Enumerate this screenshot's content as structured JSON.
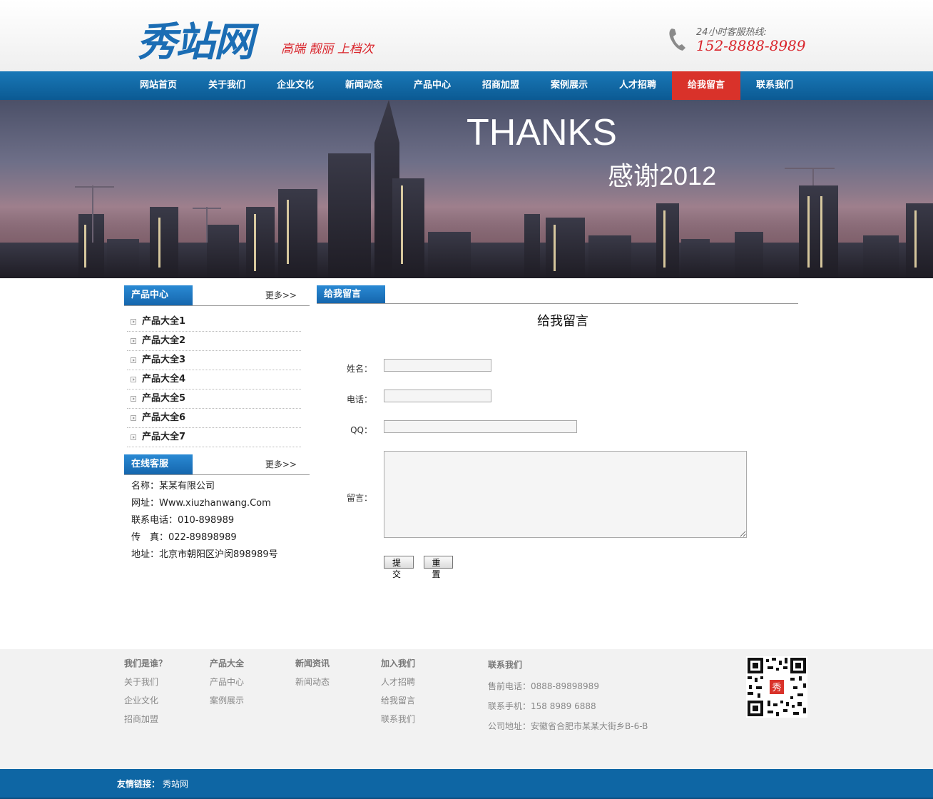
{
  "header": {
    "logo_text": "秀站网",
    "slogan": "高端 靓丽 上档次",
    "hotline_label": "24小时客服热线:",
    "hotline_number": "152-8888-8989"
  },
  "nav": {
    "items": [
      "网站首页",
      "关于我们",
      "企业文化",
      "新闻动态",
      "产品中心",
      "招商加盟",
      "案例展示",
      "人才招聘",
      "给我留言",
      "联系我们"
    ],
    "active": "给我留言"
  },
  "banner": {
    "title": "THANKS",
    "subtitle": "感谢2012"
  },
  "products": {
    "title": "产品中心",
    "more": "更多>>",
    "items": [
      "产品大全1",
      "产品大全2",
      "产品大全3",
      "产品大全4",
      "产品大全5",
      "产品大全6",
      "产品大全7"
    ]
  },
  "service": {
    "title": "在线客服",
    "more": "更多>>",
    "lines": [
      "名称：某某有限公司",
      "网址：Www.xiuzhanwang.Com",
      "联系电话：010-898989",
      "传　真：022-89898989",
      "地址：北京市朝阳区沪闵898989号"
    ]
  },
  "message": {
    "tab": "给我留言",
    "heading": "给我留言",
    "name_label": "姓名：",
    "phone_label": "电话：",
    "qq_label": "QQ：",
    "content_label": "留言：",
    "name_value": "",
    "phone_value": "",
    "qq_value": "",
    "content_value": "",
    "submit_label": "提交",
    "reset_label": "重置"
  },
  "footer": {
    "columns": [
      {
        "title": "我们是谁？",
        "links": [
          "关于我们",
          "企业文化",
          "招商加盟"
        ]
      },
      {
        "title": "产品大全",
        "links": [
          "产品中心",
          "案例展示"
        ]
      },
      {
        "title": "新闻资讯",
        "links": [
          "新闻动态"
        ]
      },
      {
        "title": "加入我们",
        "links": [
          "人才招聘",
          "给我留言",
          "联系我们"
        ]
      }
    ],
    "contact_title": "联系我们",
    "contact_lines": [
      "售前电话：0888-89898989",
      "联系手机：158 8989 6888",
      "公司地址：安徽省合肥市某某大街乡B-6-B"
    ],
    "qr_badge": "秀"
  },
  "bottom": {
    "friend_label": "友情链接：",
    "friend_link": "秀站网"
  },
  "colors": {
    "brand_blue": "#1b6db4",
    "nav_blue": "#0b5a93",
    "accent_red": "#d9322a"
  }
}
